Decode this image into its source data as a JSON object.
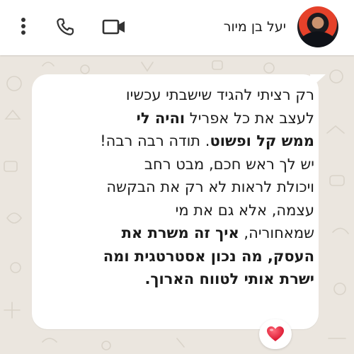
{
  "header": {
    "contact_name": "יעל בן מיור",
    "icons": [
      "more-vert-icon",
      "phone-icon",
      "video-camera-icon"
    ]
  },
  "message": {
    "lines": [
      [
        {
          "text": "רק רציתי להגיד שישבתי עכשיו",
          "bold": false
        }
      ],
      [
        {
          "text": "לעצב את כל אפריל ",
          "bold": false
        },
        {
          "text": "והיה לי",
          "bold": true
        }
      ],
      [
        {
          "text": "ממש קל ופשוט",
          "bold": true
        },
        {
          "text": ". תודה רבה רבה!",
          "bold": false
        }
      ],
      [
        {
          "text": "יש לך ראש חכם, מבט רחב",
          "bold": false
        }
      ],
      [
        {
          "text": "ויכולת לראות לא רק את הבקשה",
          "bold": false
        }
      ],
      [
        {
          "text": "עצמה, אלא גם את מי",
          "bold": false
        }
      ],
      [
        {
          "text": "שמאחוריה, ",
          "bold": false
        },
        {
          "text": "איך זה משרת את",
          "bold": true
        }
      ],
      [
        {
          "text": "העסק, מה נכון אסטרטגית ומה",
          "bold": true
        }
      ],
      [
        {
          "text": "ישרת אותי לטווח הארוך.",
          "bold": true
        }
      ]
    ]
  },
  "reaction": {
    "emoji": "❤️",
    "icon": "heart-icon"
  },
  "colors": {
    "wallpaper": "#ebe6df",
    "bubble": "#ffffff",
    "header": "#ffffff",
    "heart": "#e0243a"
  }
}
